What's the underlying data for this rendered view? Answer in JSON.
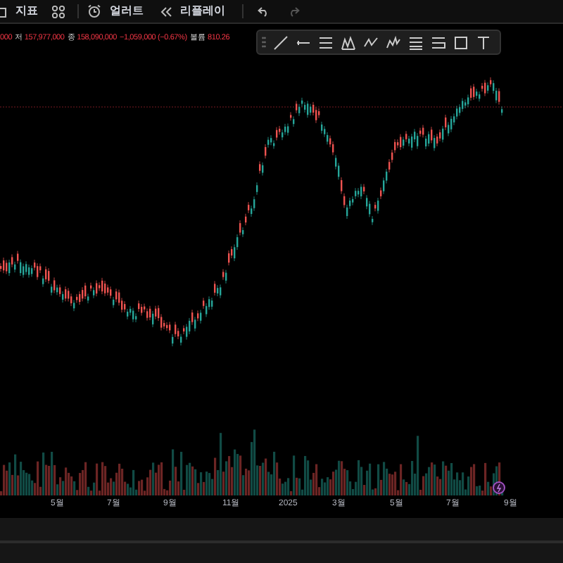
{
  "toolbar": {
    "indicators_label": "지표",
    "alerts_label": "얼러트",
    "replay_label": "리플레이"
  },
  "legend": {
    "items": [
      {
        "value": "000"
      },
      {
        "label": "저",
        "value": "157,977,000"
      },
      {
        "label": "종",
        "value": "158,090,000"
      },
      {
        "value": "−1,059,000 (−0.67%)"
      },
      {
        "label": "볼륨",
        "value": "810.26"
      }
    ]
  },
  "x_axis": {
    "labels": [
      "5월",
      "7월",
      "9월",
      "11월",
      "2025",
      "3월",
      "5월",
      "7월",
      "9월"
    ]
  }
}
